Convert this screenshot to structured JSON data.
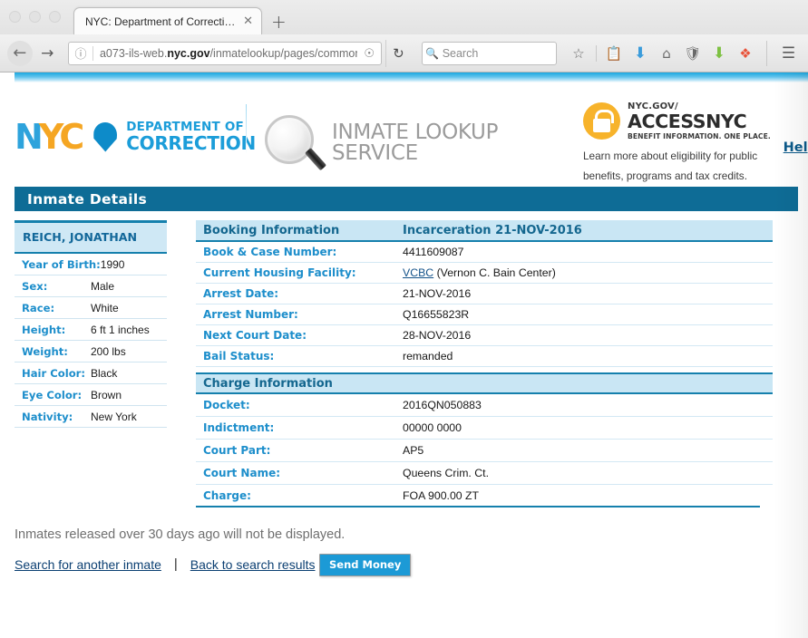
{
  "browser": {
    "tab_title": "NYC: Department of Correction |...",
    "tab_close_icon": "close-icon",
    "new_tab_icon": "plus-icon",
    "back_icon": "back-arrow-icon",
    "forward_icon": "forward-arrow-icon",
    "url_info_icon": "info-icon",
    "url": "a073-ils-web.",
    "url_bold": "nyc.gov",
    "url_rest": "/inmatelookup/pages/common",
    "url_truncate": "⁄",
    "reader_icon": "reader-mode-icon",
    "reload_icon": "reload-icon",
    "search_placeholder": "Search",
    "search_icon": "search-icon",
    "toolbar_icons": [
      "star-bookmark-icon",
      "library-icon",
      "download-arrow-icon",
      "home-icon",
      "pocket-shield-icon",
      "green-download-icon",
      "addon-colorful-icon",
      "hamburger-menu-icon"
    ]
  },
  "header": {
    "nyc_logo": {
      "n": "N",
      "y": "Y",
      "c": "C",
      "shield_icon": "nyc-shield-icon"
    },
    "department_line1": "DEPARTMENT OF",
    "department_line2": "CORRECTION",
    "magnifier_icon": "magnifying-glass-icon",
    "service_line1": "INMATE LOOKUP",
    "service_line2": "SERVICE",
    "access": {
      "lock_icon": "access-lock-icon",
      "line1": "NYC.GOV/",
      "line2": "ACCESSNYC",
      "line3": "BENEFIT INFORMATION. ONE PLACE.",
      "blurb": "Learn more about eligibility for public benefits, programs and tax credits."
    },
    "help_label": "Help"
  },
  "page": {
    "details_title": "Inmate Details"
  },
  "inmate": {
    "name": "REICH, JONATHAN",
    "fields": [
      {
        "label": "Year of Birth:",
        "value": "1990"
      },
      {
        "label": "Sex:",
        "value": "Male"
      },
      {
        "label": "Race:",
        "value": "White"
      },
      {
        "label": "Height:",
        "value": "6 ft 1 inches"
      },
      {
        "label": "Weight:",
        "value": "200 lbs"
      },
      {
        "label": "Hair Color:",
        "value": "Black"
      },
      {
        "label": "Eye Color:",
        "value": "Brown"
      },
      {
        "label": "Nativity:",
        "value": "New York"
      }
    ]
  },
  "booking": {
    "section_title": "Booking Information",
    "incarceration_title": "Incarceration 21-NOV-2016",
    "rows": [
      {
        "label": "Book & Case Number:",
        "value": "4411609087"
      },
      {
        "label": "Current Housing Facility:",
        "link": "VCBC",
        "value": " (Vernon C. Bain Center)"
      },
      {
        "label": "Arrest Date:",
        "value": "21-NOV-2016"
      },
      {
        "label": "Arrest Number:",
        "value": "Q16655823R"
      },
      {
        "label": "Next Court Date:",
        "value": "28-NOV-2016"
      },
      {
        "label": "Bail Status:",
        "value": "remanded"
      }
    ]
  },
  "charge": {
    "section_title": "Charge Information",
    "rows": [
      {
        "label": "Docket:",
        "value": "2016QN050883"
      },
      {
        "label": "Indictment:",
        "value": "00000 0000"
      },
      {
        "label": "Court Part:",
        "value": "AP5"
      },
      {
        "label": "Court Name:",
        "value": "Queens Crim. Ct."
      },
      {
        "label": "Charge:",
        "value": "FOA 900.00 ZT"
      }
    ]
  },
  "footer": {
    "note": "Inmates released over 30 days ago will not be displayed.",
    "search_another": "Search for another inmate",
    "separator": "|",
    "back_to_results": "Back to search results",
    "send_money": "Send Money"
  },
  "colors": {
    "header_bar": "#0e6c96",
    "section_header": "#c9e6f4",
    "accent_blue": "#1d8ecb",
    "link_blue": "#15538a",
    "send_money": "#1c9ad6",
    "access_orange": "#f7b32b"
  }
}
